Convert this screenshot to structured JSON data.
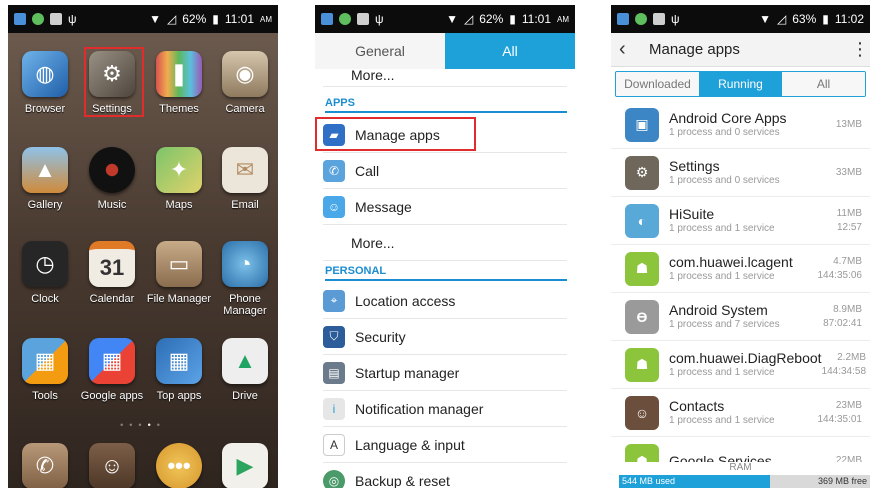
{
  "phone1": {
    "status": {
      "battery": "62%",
      "time": "11:01",
      "ampm": "AM"
    },
    "apps": [
      {
        "label": "Browser",
        "icon": "browser-icon",
        "color": "#3a7bd5"
      },
      {
        "label": "Settings",
        "icon": "settings-gear-icon",
        "color": "#7d7468"
      },
      {
        "label": "Themes",
        "icon": "themes-icon",
        "color": "#c34b2f"
      },
      {
        "label": "Camera",
        "icon": "camera-icon",
        "color": "#b8a589"
      },
      {
        "label": "Gallery",
        "icon": "gallery-icon",
        "color": "#d08a3a"
      },
      {
        "label": "Music",
        "icon": "music-icon",
        "color": "#1f1f1f"
      },
      {
        "label": "Maps",
        "icon": "maps-icon",
        "color": "#57a64a"
      },
      {
        "label": "Email",
        "icon": "email-icon",
        "color": "#e8e1d8"
      },
      {
        "label": "Clock",
        "icon": "clock-icon",
        "color": "#2c2c2c"
      },
      {
        "label": "Calendar",
        "icon": "calendar-icon",
        "color": "#e9e2d6"
      },
      {
        "label": "File Manager",
        "icon": "file-manager-icon",
        "color": "#a0876c"
      },
      {
        "label": "Phone Manager",
        "icon": "phone-manager-icon",
        "color": "#4c90c8"
      },
      {
        "label": "Tools",
        "icon": "tools-icon",
        "color": "#4a8cc8"
      },
      {
        "label": "Google apps",
        "icon": "google-apps-icon",
        "color": "#3b82c8"
      },
      {
        "label": "Top apps",
        "icon": "top-apps-icon",
        "color": "#2d6db5"
      },
      {
        "label": "Drive",
        "icon": "drive-icon",
        "color": "#e9e9e9"
      }
    ],
    "calendar_day": "31",
    "dock": [
      {
        "icon": "phone-icon",
        "color": "#a08064"
      },
      {
        "icon": "contacts-icon",
        "color": "#6b4f3c"
      },
      {
        "icon": "messaging-icon",
        "color": "#e6b74a"
      },
      {
        "icon": "play-store-icon",
        "color": "#f0efea"
      }
    ]
  },
  "phone2": {
    "status": {
      "battery": "62%",
      "time": "11:01",
      "ampm": "AM"
    },
    "tabs": [
      "General",
      "All"
    ],
    "more_top": "More...",
    "section_apps": "APPS",
    "manage_apps": "Manage apps",
    "call": "Call",
    "message": "Message",
    "more2": "More...",
    "section_personal": "PERSONAL",
    "location": "Location access",
    "security": "Security",
    "startup": "Startup manager",
    "notification": "Notification manager",
    "language": "Language & input",
    "backup": "Backup & reset"
  },
  "phone3": {
    "status": {
      "battery": "63%",
      "time": "11:02"
    },
    "title": "Manage apps",
    "seg": [
      "Downloaded",
      "Running",
      "All"
    ],
    "apps": [
      {
        "name": "Android Core Apps",
        "sub": "1 process and 0 services",
        "size": "13MB",
        "time": "",
        "color": "#3d86c6",
        "icon": "android-core-apps-icon"
      },
      {
        "name": "Settings",
        "sub": "1 process and 0 services",
        "size": "33MB",
        "time": "",
        "color": "#6f675c",
        "icon": "settings-gear-icon"
      },
      {
        "name": "HiSuite",
        "sub": "1 process and 1 service",
        "size": "11MB",
        "time": "12:57",
        "color": "#58a8d8",
        "icon": "hisuite-icon"
      },
      {
        "name": "com.huawei.lcagent",
        "sub": "1 process and 1 service",
        "size": "4.7MB",
        "time": "144:35:06",
        "color": "#8cc43c",
        "icon": "android-robot-icon"
      },
      {
        "name": "Android System",
        "sub": "1 process and 7 services",
        "size": "8.9MB",
        "time": "87:02:41",
        "color": "#9a9a9a",
        "icon": "android-system-icon"
      },
      {
        "name": "com.huawei.DiagReboot",
        "sub": "1 process and 1 service",
        "size": "2.2MB",
        "time": "144:34:58",
        "color": "#8cc43c",
        "icon": "android-robot-icon"
      },
      {
        "name": "Contacts",
        "sub": "1 process and 1 service",
        "size": "23MB",
        "time": "144:35:01",
        "color": "#6b4f3c",
        "icon": "contacts-icon"
      },
      {
        "name": "Google Services",
        "sub": "",
        "size": "22MB",
        "time": "",
        "color": "#8cc43c",
        "icon": "android-robot-icon"
      }
    ],
    "ram_label": "RAM",
    "ram_used": "544 MB used",
    "ram_free": "369 MB free",
    "ram_used_fraction": 0.6
  },
  "colors": {
    "accent": "#1ea0d9",
    "highlight": "#e02c2c"
  }
}
